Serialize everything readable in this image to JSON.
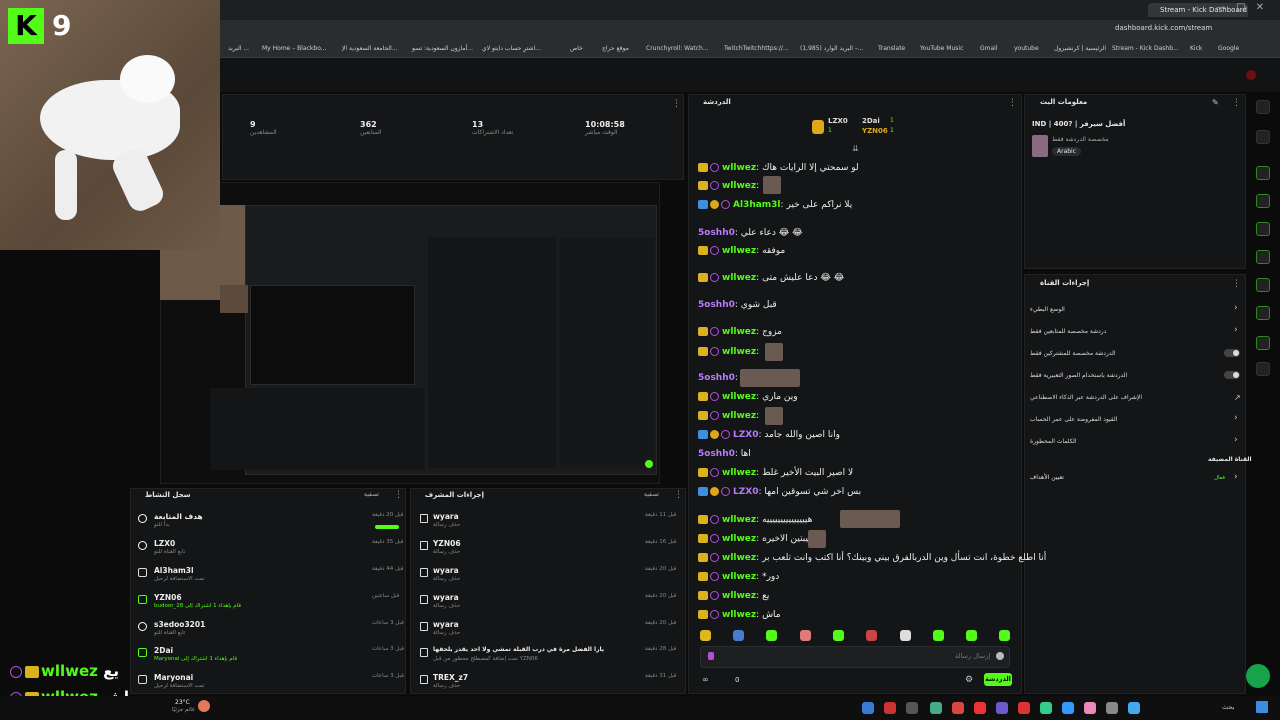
{
  "browser": {
    "tab_title": "Stream - Kick Dashboard",
    "url": "dashboard.kick.com/stream",
    "bookmarks": [
      "البريد ...",
      "My Home – Blackbo...",
      "الجامعة السعودية الإ...",
      "أمازون السعودية: تسو...",
      "اشترِ حساب دايتو لاي...",
      "خاص",
      "موقع حراج",
      "Crunchyroll: Watch...",
      "TwitchTwitchhttps://...",
      "(1,985) البريد الوارد –...",
      "Translate",
      "YouTube Music",
      "Gmail",
      "youtube",
      "الرئيسية | كرنشيرول",
      "Stream - Kick Dashb...",
      "Kick",
      "Google"
    ]
  },
  "cam": {
    "logo_letter": "K",
    "logo_number": "9"
  },
  "stats": [
    {
      "value": "9",
      "label": "المشاهدين"
    },
    {
      "value": "362",
      "label": "المتابعين"
    },
    {
      "value": "13",
      "label": "تعداد الاشتراكات"
    },
    {
      "value": "10:08:58",
      "label": "الوقت مباشر"
    }
  ],
  "chat": {
    "header": "الدردشة",
    "top_users": [
      {
        "name": "LZX0",
        "count": "1"
      },
      {
        "name": "2Dai",
        "count": "1"
      },
      {
        "name": "YZN06",
        "count": "1"
      }
    ],
    "input_placeholder": "إرسال رسالة",
    "send_label": "الدردشة",
    "footer_count": "0",
    "messages": [
      {
        "user": "wllwez",
        "text": "لو سمحتي إلا الرايات هاك",
        "style": "crown"
      },
      {
        "user": "wllwez",
        "text": "",
        "style": "crown"
      },
      {
        "user": "Al3ham3l",
        "text": "يلا نراكم على خير",
        "style": "badges"
      },
      {
        "user": "5oshh0",
        "text": "دعاء علي 😂 😂",
        "style": "plain"
      },
      {
        "user": "wllwez",
        "text": "موفقه",
        "style": "crown"
      },
      {
        "user": "wllwez",
        "text": "دعا عليش متى 😂 😂",
        "style": "crown"
      },
      {
        "user": "5oshh0",
        "text": "قبل شوي",
        "style": "plain"
      },
      {
        "user": "wllwez",
        "text": "مزوج",
        "style": "crown"
      },
      {
        "user": "wllwez",
        "text": "",
        "style": "crown"
      },
      {
        "user": "5oshh0",
        "text": "",
        "style": "plain"
      },
      {
        "user": "wllwez",
        "text": "وين ماري",
        "style": "crown"
      },
      {
        "user": "wllwez",
        "text": "",
        "style": "crown"
      },
      {
        "user": "LZX0",
        "text": "وانا اصين والله جامد",
        "style": "badges"
      },
      {
        "user": "5oshh0",
        "text": "اها",
        "style": "plain"
      },
      {
        "user": "wllwez",
        "text": "لا اصير البيت الأخير غلط",
        "style": "crown"
      },
      {
        "user": "LZX0",
        "text": "بس اخر شي تسوقين امها",
        "style": "badges"
      },
      {
        "user": "wllwez",
        "text": "هيييييييييييييييه",
        "style": "crown"
      },
      {
        "user": "wllwez",
        "text": "الليبتين الاخيره",
        "style": "crown"
      },
      {
        "user": "wllwez",
        "text": "أنا اطلع خطوة، انت تسأل وين الدربالفرق بيني وبينك؟ أنا اكتب وانت تلعب بر",
        "style": "crown"
      },
      {
        "user": "wllwez",
        "text": "*دور",
        "style": "crown"
      },
      {
        "user": "wllwez",
        "text": "يع",
        "style": "crown"
      },
      {
        "user": "wllwez",
        "text": "ماش",
        "style": "crown"
      }
    ]
  },
  "stream_info": {
    "header": "معلومات البث",
    "title": "IND | 400? | أفضل سيرفر",
    "subtitle": "مخصصة الدردشة فقط",
    "language": "Arabic"
  },
  "channel_actions": {
    "header": "إجراءات القناة",
    "items": [
      {
        "label": "الوضع البطيء",
        "control": "chevron"
      },
      {
        "label": "دردشة مخصصة للمتابعين فقط",
        "control": "chevron"
      },
      {
        "label": "الدردشة مخصصة للمشتركين فقط",
        "control": "toggle"
      },
      {
        "label": "الدردشة باستخدام الصور التعبيرية فقط",
        "control": "toggle"
      },
      {
        "label": "الإشراف على الدردشة عبر الذكاء الاصطناعي",
        "control": "link"
      },
      {
        "label": "القيود المفروضة على عمر الحساب",
        "control": "chevron"
      },
      {
        "label": "الكلمات المحظورة",
        "control": "chevron"
      }
    ],
    "pinned_label": "القناة المضيفة",
    "goal_label": "تعيين الأهداف",
    "goal_status": "فعال"
  },
  "activity_feed": {
    "header": "سجل النشاط",
    "filter": "تصفية",
    "items": [
      {
        "name": "هدف المتابعة",
        "sub": "بدأ للتو",
        "time": "قبل 20 دقيقة",
        "icon": "heart"
      },
      {
        "name": "LZX0",
        "sub": "تابع القناة للتو",
        "time": "قبل 35 دقيقة",
        "icon": "heart"
      },
      {
        "name": "Al3ham3l",
        "sub": "تمت الاستضافة لرحيل",
        "time": "قبل 44 دقيقة",
        "icon": "host"
      },
      {
        "name": "YZN06",
        "sub": "budoor_28 قام بإهداء 1 اشتراك إلى",
        "time": "قبل ساعتين",
        "icon": "gift"
      },
      {
        "name": "s3edoo3201",
        "sub": "تابع القناة للتو",
        "time": "قبل 3 ساعات",
        "icon": "heart"
      },
      {
        "name": "2Dai",
        "sub": "Maryonai قام بإهداء 1 اشتراك إلى",
        "time": "قبل 3 ساعات",
        "icon": "gift"
      },
      {
        "name": "Maryonai",
        "sub": "تمت الاستضافة لرحيل",
        "time": "قبل 3 ساعات",
        "icon": "host"
      }
    ]
  },
  "mod_actions": {
    "header": "إجراءات المشرف",
    "filter": "تصفية",
    "items": [
      {
        "name": "wyara",
        "sub": "حذف رسالة",
        "time": "قبل 11 دقيقة"
      },
      {
        "name": "YZN06",
        "sub": "حذف رسالة",
        "time": "قبل 16 دقيقة"
      },
      {
        "name": "wyara",
        "sub": "حذف رسالة",
        "time": "قبل 20 دقيقة"
      },
      {
        "name": "wyara",
        "sub": "حذف رسالة",
        "time": "قبل 20 دقيقة"
      },
      {
        "name": "wyara",
        "sub": "حذف رسالة",
        "time": "قبل 20 دقيقة"
      },
      {
        "name": "يارا الفضل مرة في درب القبلة تمشي ولا احد يقدر يلحقها",
        "sub": "تمت إضافة كمصطلح محظور من قبل YZN06",
        "time": "قبل 28 دقيقة"
      },
      {
        "name": "TREX_z7",
        "sub": "حذف رسالة",
        "time": "قبل 31 دقيقة"
      }
    ]
  },
  "overlay_chat": [
    {
      "user": "wllwez",
      "text": "يع"
    },
    {
      "user": "wllwez",
      "text": "ماش"
    }
  ],
  "taskbar": {
    "weather": "23°C",
    "weather_sub": "غائم جزئيًا",
    "search": "بحث"
  }
}
